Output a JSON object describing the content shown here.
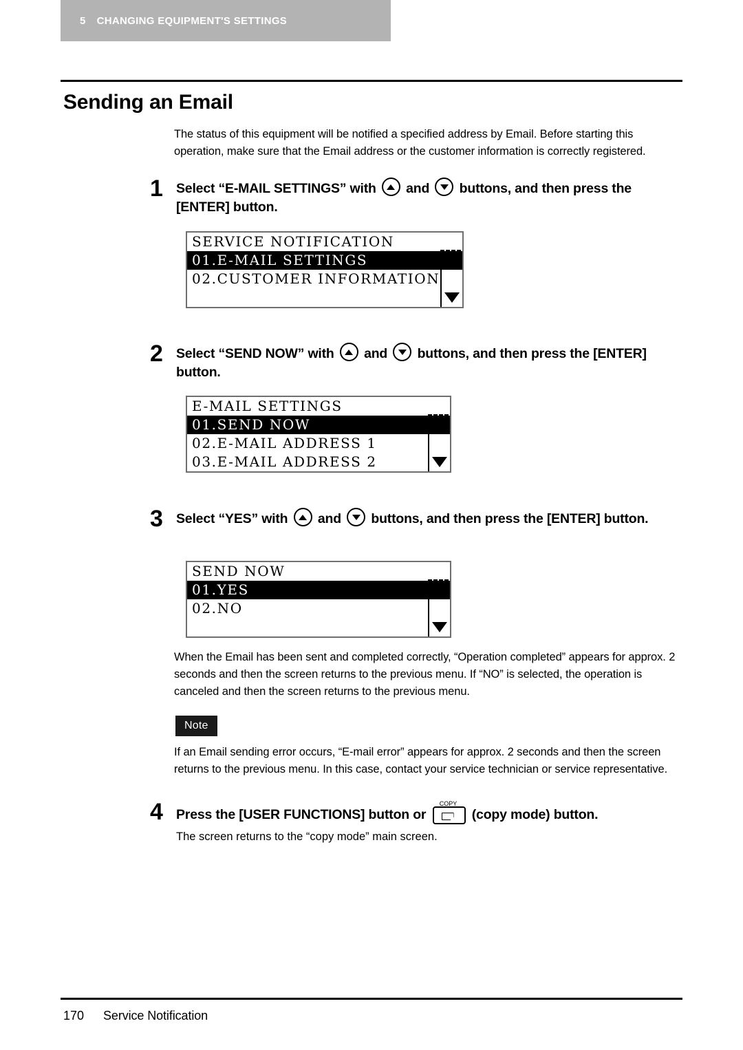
{
  "header": {
    "chapter_number": "5",
    "chapter_title": "CHANGING EQUIPMENT'S SETTINGS"
  },
  "section": {
    "title": "Sending an Email",
    "intro": "The status of this equipment will be notified a specified address by Email. Before starting this operation, make sure that the Email address or the customer information is correctly registered."
  },
  "steps": [
    {
      "number": "1",
      "text_part1": "Select “E-MAIL SETTINGS” with",
      "text_part2": "and",
      "text_part3": "buttons, and then press the [ENTER] button."
    },
    {
      "number": "2",
      "text_part1": "Select “SEND NOW” with",
      "text_part2": "and",
      "text_part3": "buttons, and then press the [ENTER] button."
    },
    {
      "number": "3",
      "text_part1": "Select “YES” with",
      "text_part2": "and",
      "text_part3": "buttons, and then press the [ENTER] button."
    },
    {
      "number": "4",
      "text_part1": "Press the [USER FUNCTIONS] button or",
      "copy_key_label": "COPY",
      "text_part3": "(copy mode) button.",
      "subtext": "The screen returns to the “copy mode” main screen."
    }
  ],
  "lcd_screens": [
    {
      "title": "SERVICE NOTIFICATION",
      "rows": [
        {
          "text": "01.E-MAIL SETTINGS",
          "selected": true
        },
        {
          "text": "02.CUSTOMER INFORMATION",
          "selected": false
        },
        {
          "text": "",
          "selected": false
        }
      ],
      "scroll_up_icon": "triangle-up",
      "scroll_down_icon": "triangle-down"
    },
    {
      "title": "E-MAIL SETTINGS",
      "rows": [
        {
          "text": "01.SEND NOW",
          "selected": true
        },
        {
          "text": "02.E-MAIL ADDRESS 1",
          "selected": false
        },
        {
          "text": "03.E-MAIL ADDRESS 2",
          "selected": false
        }
      ],
      "scroll_up_icon": "triangle-up",
      "scroll_down_icon": "triangle-down"
    },
    {
      "title": "SEND NOW",
      "rows": [
        {
          "text": "01.YES",
          "selected": true
        },
        {
          "text": "02.NO",
          "selected": false
        },
        {
          "text": "",
          "selected": false
        }
      ],
      "scroll_up_icon": "triangle-up",
      "scroll_down_icon": "triangle-down"
    }
  ],
  "result_paragraph": "When the Email has been sent and completed correctly, “Operation completed” appears for approx. 2 seconds and then the screen returns to the previous menu. If “NO” is selected, the operation is canceled and then the screen returns to the previous menu.",
  "note": {
    "badge": "Note",
    "text": "If an Email sending error occurs, “E-mail error” appears for approx. 2 seconds and then the screen returns to the previous menu. In this case, contact your service technician or service representative."
  },
  "footer": {
    "page_number": "170",
    "page_label": "Service Notification"
  },
  "colors": {
    "header_band": "#b3b3b3",
    "note_badge_bg": "#1a1a1a",
    "lcd_border": "#6f6f6f",
    "selection": "#000000"
  }
}
